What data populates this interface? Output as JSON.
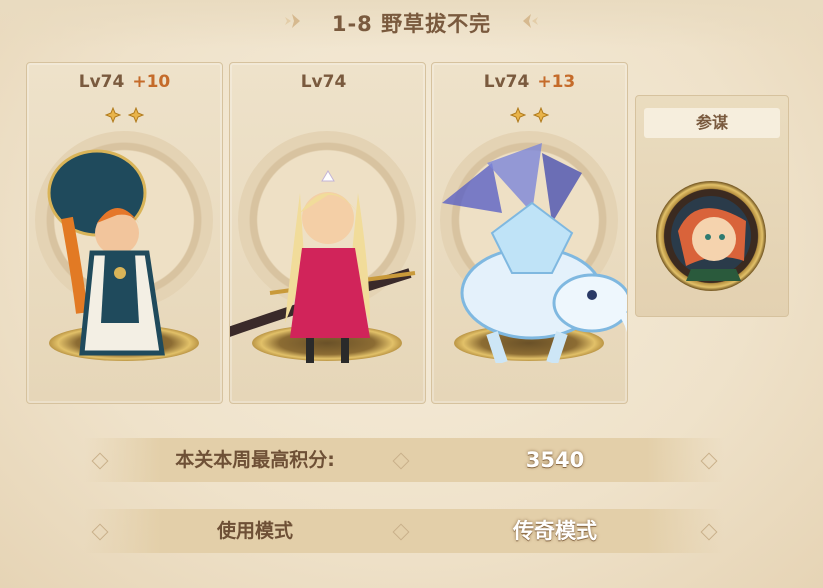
{
  "stage": {
    "title": "1-8 野草拔不完"
  },
  "team": [
    {
      "level": "Lv74",
      "bonus": "+10",
      "stars": 2
    },
    {
      "level": "Lv74",
      "bonus": "",
      "stars": 0
    },
    {
      "level": "Lv74",
      "bonus": "+13",
      "stars": 2
    }
  ],
  "advisor": {
    "label": "参谋"
  },
  "score": {
    "label": "本关本周最高积分:",
    "value": "3540"
  },
  "mode": {
    "label": "使用模式",
    "value": "传奇模式"
  },
  "colors": {
    "accent": "#c56b2a",
    "text": "#7a5a3e",
    "panel": "#e3cfa9"
  }
}
